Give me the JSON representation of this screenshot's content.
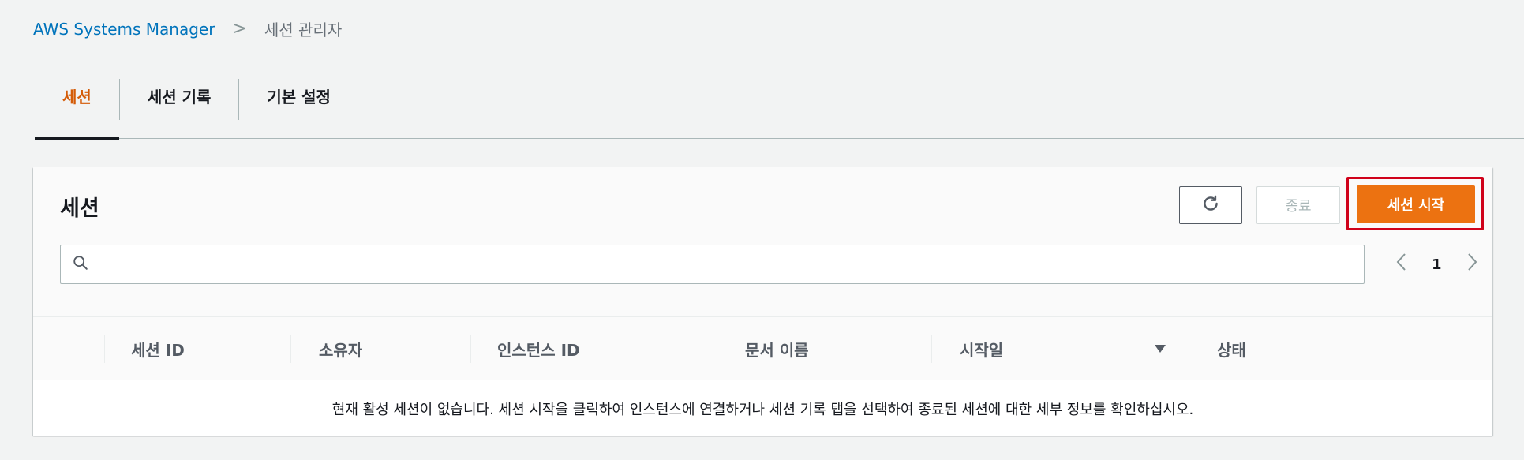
{
  "breadcrumb": {
    "root": "AWS Systems Manager",
    "separator": ">",
    "current": "세션 관리자"
  },
  "tabs": [
    {
      "label": "세션",
      "active": true
    },
    {
      "label": "세션 기록",
      "active": false
    },
    {
      "label": "기본 설정",
      "active": false
    }
  ],
  "panel": {
    "title": "세션",
    "buttons": {
      "refresh_icon": "refresh-icon",
      "terminate_label": "종료",
      "start_label": "세션 시작"
    },
    "search": {
      "placeholder": "",
      "value": ""
    },
    "pagination": {
      "current_page": "1",
      "prev_symbol": "‹",
      "next_symbol": "›"
    },
    "table": {
      "columns": [
        "세션 ID",
        "소유자",
        "인스턴스 ID",
        "문서 이름",
        "시작일",
        "상태"
      ],
      "sorted_column": "시작일",
      "sort_direction": "descending",
      "empty_message": "현재 활성 세션이 없습니다. 세션 시작을 클릭하여 인스턴스에 연결하거나 세션 기록 탭을 선택하여 종료된 세션에 대한 세부 정보를 확인하십시오."
    }
  },
  "colors": {
    "accent_orange": "#ec7211",
    "active_tab": "#d45b07",
    "link_blue": "#0073bb",
    "highlight_red": "#d0021b"
  }
}
